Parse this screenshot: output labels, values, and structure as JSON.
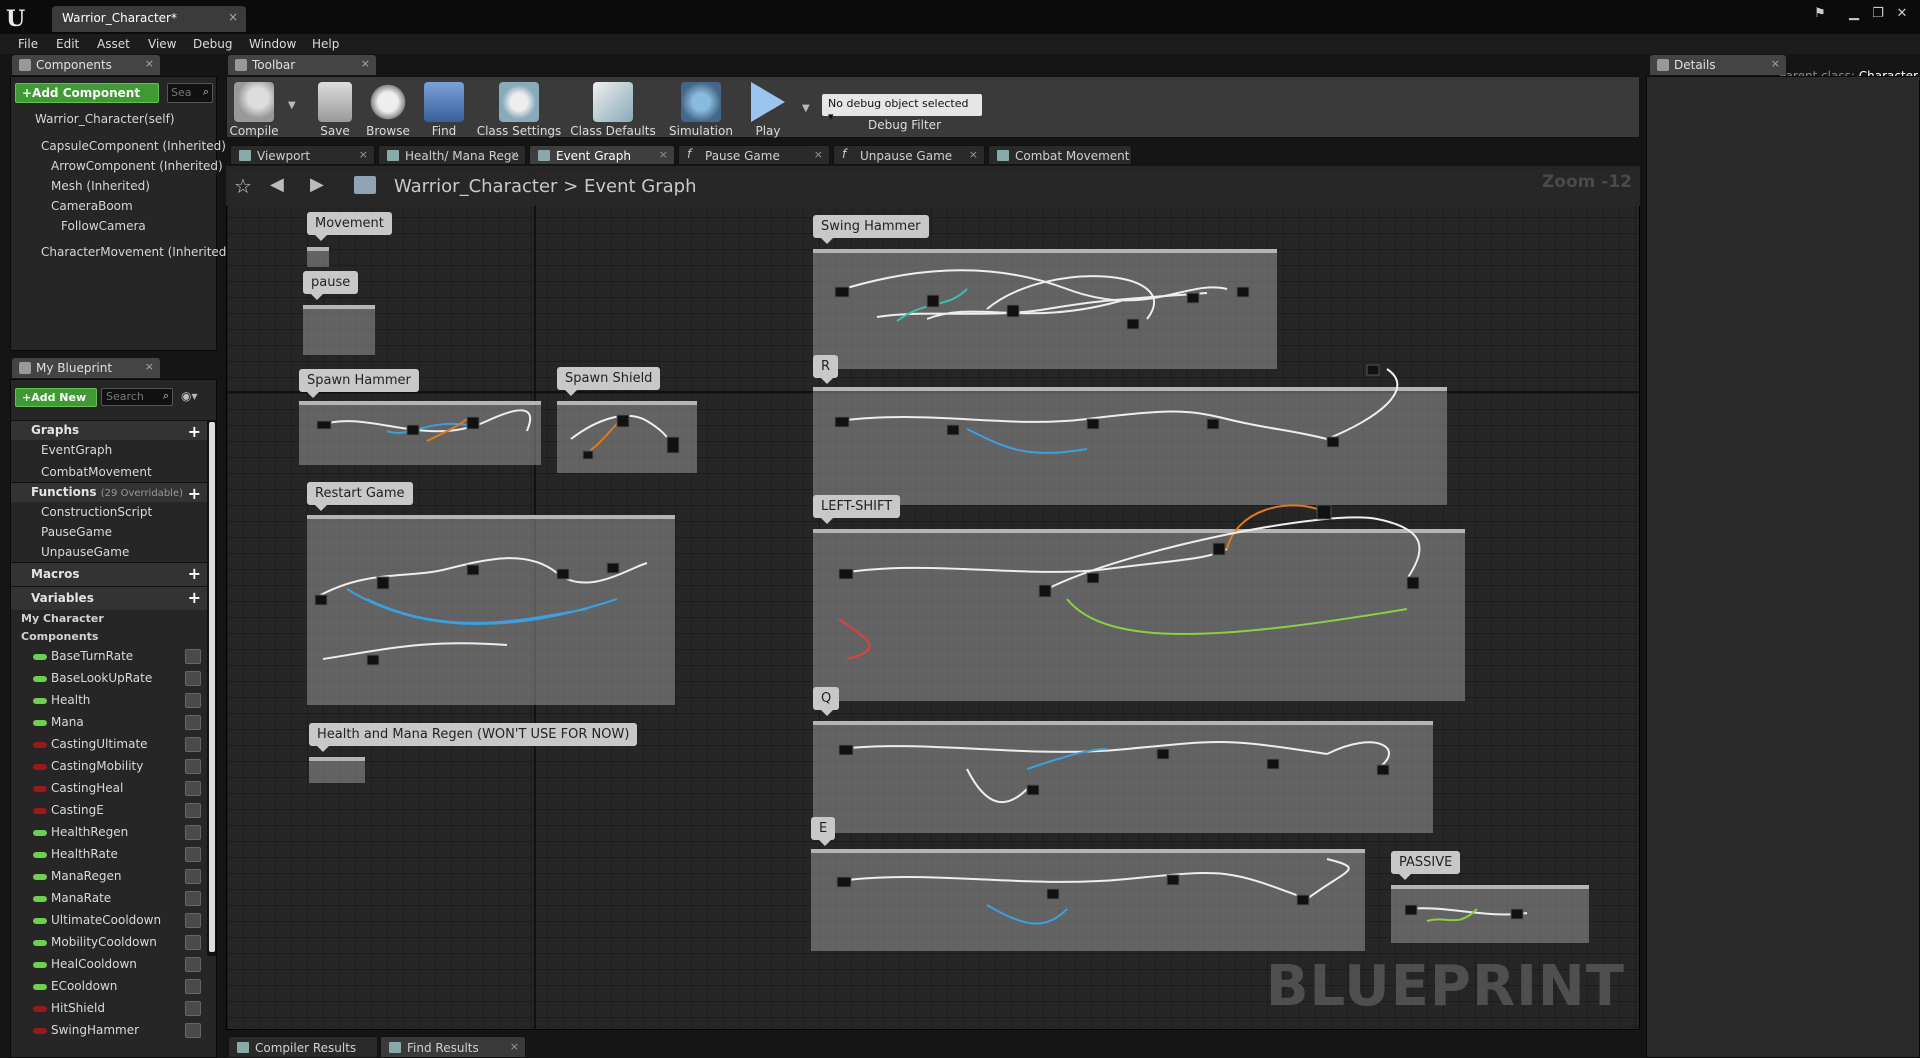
{
  "window": {
    "doc_tab": "Warrior_Character*",
    "parent_class_label": "Parent class:",
    "parent_class_value": "Character"
  },
  "menu": [
    "File",
    "Edit",
    "Asset",
    "View",
    "Debug",
    "Window",
    "Help"
  ],
  "components_panel": {
    "tab": "Components",
    "add_button": "+Add Component",
    "search_placeholder": "Sea",
    "items": [
      "Warrior_Character(self)",
      "CapsuleComponent (Inherited)",
      "ArrowComponent (Inherited)",
      "Mesh (Inherited)",
      "CameraBoom",
      "FollowCamera",
      "CharacterMovement (Inherited)"
    ]
  },
  "toolbar": {
    "tab": "Toolbar",
    "buttons": [
      "Compile",
      "Save",
      "Browse",
      "Find",
      "Class Settings",
      "Class Defaults",
      "Simulation",
      "Play"
    ],
    "debug_select": "No debug object selected",
    "debug_filter": "Debug Filter"
  },
  "editor_tabs": [
    "Viewport",
    "Health/ Mana Rege",
    "Event Graph",
    "Pause Game",
    "Unpause Game",
    "Combat Movement"
  ],
  "breadcrumb": {
    "root": "Warrior_Character",
    "sep": ">",
    "current": "Event Graph"
  },
  "zoom": "Zoom -12",
  "watermark": "BLUEPRINT",
  "my_blueprint": {
    "tab": "My Blueprint",
    "add_button": "+Add New",
    "search_placeholder": "Search",
    "graphs_header": "Graphs",
    "graphs": [
      "EventGraph",
      "CombatMovement"
    ],
    "functions_header": "Functions",
    "functions_note": "(29 Overridable)",
    "functions": [
      "ConstructionScript",
      "PauseGame",
      "UnpauseGame"
    ],
    "macros_header": "Macros",
    "variables_header": "Variables",
    "var_categories": [
      "My Character",
      "Components"
    ],
    "variables": [
      {
        "name": "BaseTurnRate",
        "color": "#6bd04a"
      },
      {
        "name": "BaseLookUpRate",
        "color": "#6bd04a"
      },
      {
        "name": "Health",
        "color": "#6bd04a"
      },
      {
        "name": "Mana",
        "color": "#6bd04a"
      },
      {
        "name": "CastingUltimate",
        "color": "#9a1a1a"
      },
      {
        "name": "CastingMobility",
        "color": "#9a1a1a"
      },
      {
        "name": "CastingHeal",
        "color": "#9a1a1a"
      },
      {
        "name": "CastingE",
        "color": "#9a1a1a"
      },
      {
        "name": "HealthRegen",
        "color": "#6bd04a"
      },
      {
        "name": "HealthRate",
        "color": "#6bd04a"
      },
      {
        "name": "ManaRegen",
        "color": "#6bd04a"
      },
      {
        "name": "ManaRate",
        "color": "#6bd04a"
      },
      {
        "name": "UltimateCooldown",
        "color": "#6bd04a"
      },
      {
        "name": "MobilityCooldown",
        "color": "#6bd04a"
      },
      {
        "name": "HealCooldown",
        "color": "#6bd04a"
      },
      {
        "name": "ECooldown",
        "color": "#6bd04a"
      },
      {
        "name": "HitShield",
        "color": "#9a1a1a"
      },
      {
        "name": "SwingHammer",
        "color": "#9a1a1a"
      }
    ]
  },
  "details_tab": "Details",
  "comments": [
    "Movement",
    "pause",
    "Spawn Hammer",
    "Spawn Shield",
    "Restart Game",
    "Health and Mana Regen (WON'T USE FOR NOW)",
    "Swing Hammer",
    "R",
    "LEFT-SHIFT",
    "Q",
    "E",
    "PASSIVE"
  ],
  "bottom_tabs": [
    "Compiler Results",
    "Find Results"
  ]
}
